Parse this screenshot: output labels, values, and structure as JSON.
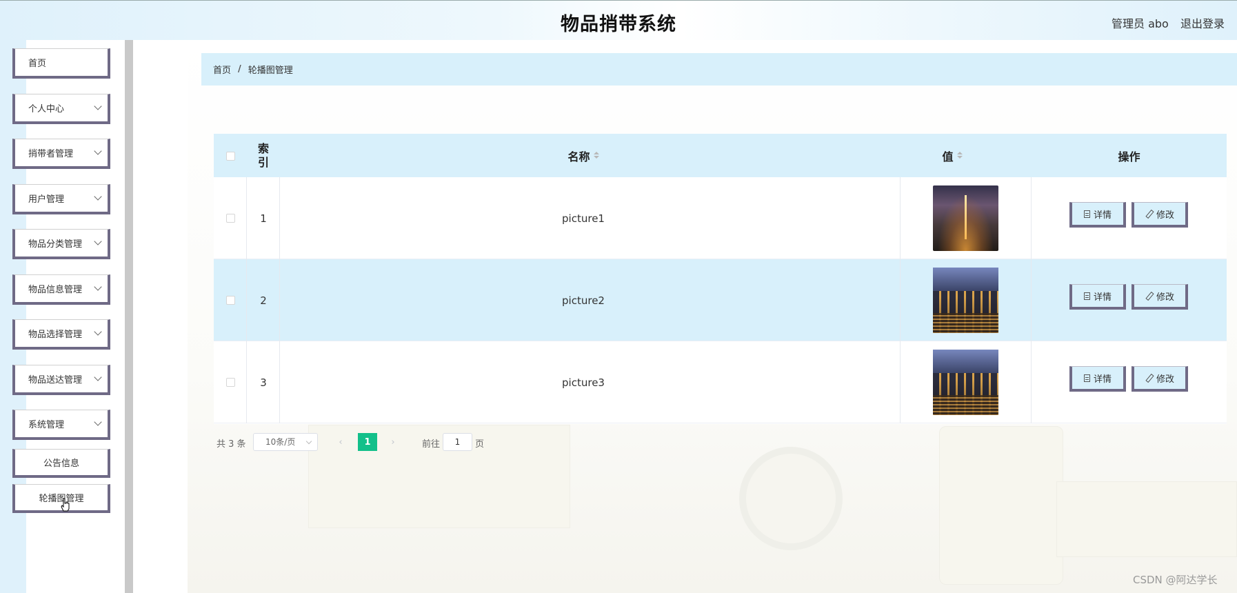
{
  "header": {
    "title": "物品捎带系统",
    "user": "管理员 abo",
    "logout": "退出登录"
  },
  "sidebar": {
    "items": [
      {
        "label": "首页",
        "has_children": false
      },
      {
        "label": "个人中心",
        "has_children": true
      },
      {
        "label": "捎带者管理",
        "has_children": true
      },
      {
        "label": "用户管理",
        "has_children": true
      },
      {
        "label": "物品分类管理",
        "has_children": true
      },
      {
        "label": "物品信息管理",
        "has_children": true
      },
      {
        "label": "物品选择管理",
        "has_children": true
      },
      {
        "label": "物品送达管理",
        "has_children": true
      },
      {
        "label": "系统管理",
        "has_children": true
      }
    ],
    "subitems": [
      {
        "label": "公告信息"
      },
      {
        "label": "轮播图管理"
      }
    ]
  },
  "breadcrumb": {
    "home": "首页",
    "separator": "/",
    "current": "轮播图管理"
  },
  "table": {
    "columns": {
      "index": "索引",
      "name": "名称",
      "value": "值",
      "actions": "操作"
    },
    "rows": [
      {
        "index": "1",
        "name": "picture1",
        "thumbnail": "night-city-tower"
      },
      {
        "index": "2",
        "name": "picture2",
        "thumbnail": "canal-buildings-night"
      },
      {
        "index": "3",
        "name": "picture3",
        "thumbnail": "canal-buildings-night"
      }
    ],
    "detail_label": "详情",
    "edit_label": "修改"
  },
  "pagination": {
    "total": "共 3 条",
    "page_size": "10条/页",
    "current_page": "1",
    "goto_label": "前往",
    "goto_value": "1",
    "goto_suffix": "页"
  },
  "watermark": "CSDN @阿达学长",
  "colors": {
    "accent": "#13c08a",
    "light_blue": "#d8f0fb",
    "border_purple": "#6f6a86"
  }
}
